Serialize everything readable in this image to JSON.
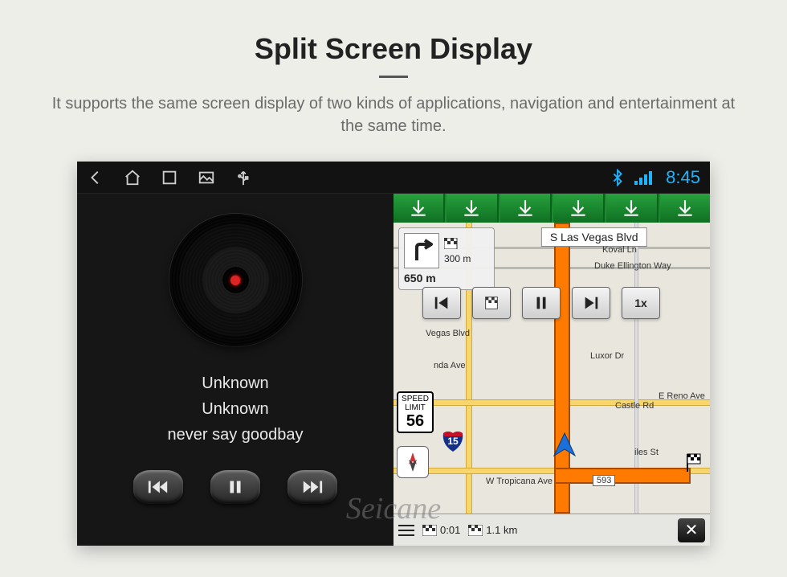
{
  "page": {
    "title": "Split Screen Display",
    "subtitle": "It supports the same screen display of two kinds of applications, navigation and entertainment at the same time."
  },
  "statusbar": {
    "time": "8:45"
  },
  "music": {
    "artist": "Unknown",
    "album": "Unknown",
    "track": "never say goodbay"
  },
  "nav": {
    "turn_distance": "300 m",
    "total_distance": "650 m",
    "top_street": "S Las Vegas Blvd",
    "sim_speed_label": "1x",
    "speed_limit_label": "SPEED LIMIT",
    "speed_limit_value": "56",
    "interstate": "15",
    "street_tropicana": "W Tropicana Ave",
    "street_tropicana_num": "593",
    "street_reno": "E Reno Ave",
    "street_duke": "Duke Ellington Way",
    "street_koval": "Koval Ln",
    "street_vegas_blvd": "Vegas Blvd",
    "street_luxor": "Luxor Dr",
    "street_hacienda": "nda Ave",
    "street_castle": "Castle Rd",
    "street_giles": "iles St",
    "bottom_eta": "0:01",
    "bottom_remaining": "1.1 km"
  },
  "watermark": "Seicane"
}
